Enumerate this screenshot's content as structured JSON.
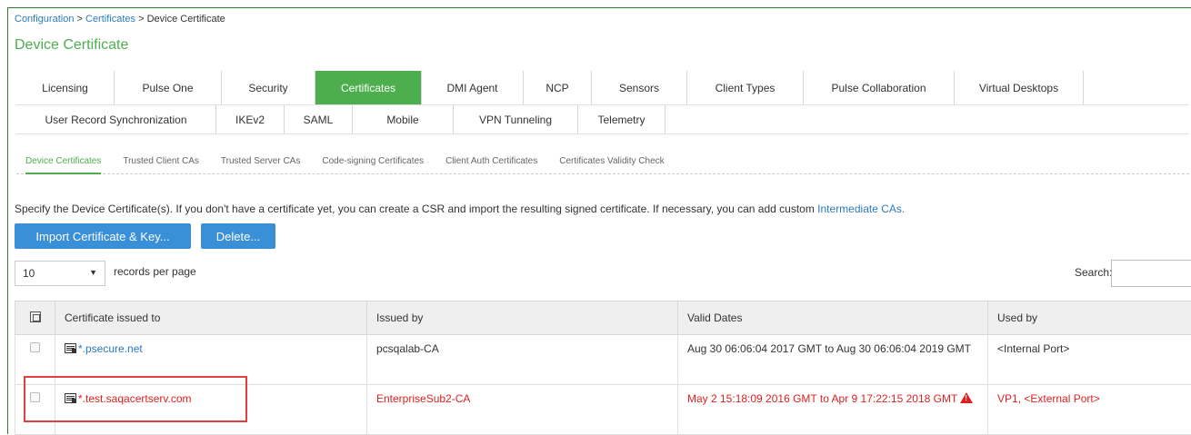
{
  "breadcrumb": {
    "items": [
      "Configuration",
      "Certificates"
    ],
    "separator": ">",
    "current": "Device Certificate"
  },
  "page_title": "Device Certificate",
  "tabs_row1": [
    {
      "label": "Licensing"
    },
    {
      "label": "Pulse One"
    },
    {
      "label": "Security"
    },
    {
      "label": "Certificates",
      "active": true
    },
    {
      "label": "DMI Agent"
    },
    {
      "label": "NCP"
    },
    {
      "label": "Sensors"
    },
    {
      "label": "Client Types"
    },
    {
      "label": "Pulse Collaboration"
    },
    {
      "label": "Virtual Desktops"
    }
  ],
  "tabs_row2": [
    {
      "label": "User Record Synchronization"
    },
    {
      "label": "IKEv2"
    },
    {
      "label": "SAML"
    },
    {
      "label": "Mobile"
    },
    {
      "label": "VPN Tunneling"
    },
    {
      "label": "Telemetry"
    }
  ],
  "subtabs": [
    {
      "label": "Device Certificates",
      "active": true
    },
    {
      "label": "Trusted Client CAs"
    },
    {
      "label": "Trusted Server CAs"
    },
    {
      "label": "Code-signing Certificates"
    },
    {
      "label": "Client Auth Certificates"
    },
    {
      "label": "Certificates Validity Check"
    }
  ],
  "description": {
    "text": "Specify the Device Certificate(s). If you don't have a certificate yet, you can create a CSR and import the resulting signed certificate. If necessary, you can add custom",
    "link": "Intermediate CAs."
  },
  "buttons": {
    "import": "Import Certificate & Key...",
    "delete": "Delete..."
  },
  "paging": {
    "page_size": "10",
    "records_label": "records per page",
    "search_label": "Search:"
  },
  "table": {
    "headers": [
      "Certificate issued to",
      "Issued by",
      "Valid Dates",
      "Used by"
    ],
    "rows": [
      {
        "issued_to": "*.psecure.net",
        "issued_by": "pcsqalab-CA",
        "valid_dates": "Aug 30 06:06:04 2017 GMT to Aug 30 06:06:04 2019 GMT",
        "used_by": "<Internal Port>",
        "expired": false
      },
      {
        "issued_to": "*.test.saqacertserv.com",
        "issued_by": "EnterpriseSub2-CA",
        "valid_dates": "May 2 15:18:09 2016 GMT to Apr 9 17:22:15 2018 GMT",
        "used_by_link": "VP1",
        "used_by": ", <External Port>",
        "expired": true
      }
    ]
  },
  "colors": {
    "accent_green": "#4cae4c",
    "link_blue": "#2a7bbf",
    "button_blue": "#3a8fd9",
    "error_red": "#e02020"
  }
}
